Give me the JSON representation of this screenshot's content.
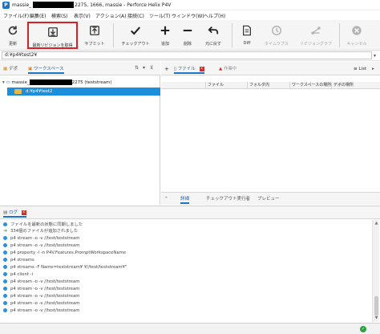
{
  "window": {
    "title_prefix": "massie_",
    "title_suffix": "2275, 1666, massie - Perforce Helix P4V"
  },
  "menu": [
    "ファイル(F)",
    "編集(E)",
    "検索(S)",
    "表示(V)",
    "アクション(A)",
    "接続(C)",
    "ツール(T)",
    "ウィンドウ(W)",
    "ヘルプ(H)"
  ],
  "toolbar": {
    "refresh": "更新",
    "get_latest": "最新リビジョンを取得",
    "submit": "サブミット",
    "checkout": "チェックアウト",
    "add": "追加",
    "delete": "削除",
    "revert": "元に戻す",
    "diff": "Diff",
    "timelapse": "タイムラプス",
    "revision_graph": "リビジョングラフ",
    "cancel": "キャンセル"
  },
  "path": {
    "value": "d:¥p4¥test2¥"
  },
  "left": {
    "tabs": [
      "デポ",
      "ワークスペース"
    ],
    "workspace_prefix": "massie_",
    "workspace_suffix": "2275 (teststream)",
    "selected_folder": "d:¥p4¥test2"
  },
  "right": {
    "tabs": [
      "ファイル",
      "作業中"
    ],
    "list_label": "List",
    "columns": [
      "ファイル",
      "フォルダ内",
      "ワークスペースの場所",
      "デポの場所"
    ],
    "bottom_tabs": [
      "詳細",
      "チェックアウト実行者",
      "プレビュー"
    ]
  },
  "log": {
    "tab": "ログ",
    "lines": [
      {
        "type": "info",
        "text": "ファイルを最新の状態に同期しました"
      },
      {
        "type": "ok",
        "text": "334個のファイルが追加されました"
      },
      {
        "type": "info",
        "text": "p4 stream -o -v //test/teststream"
      },
      {
        "type": "info",
        "text": "p4 stream -o -v //test/teststream"
      },
      {
        "type": "info",
        "text": "p4 property -l -n P4V.Features.PromptWorkspaceName"
      },
      {
        "type": "info",
        "text": "p4 streams"
      },
      {
        "type": "info",
        "text": "p4 streams -F Name=teststream¥ ¥//test/teststream¥\""
      },
      {
        "type": "info",
        "text": "p4 client -i"
      },
      {
        "type": "info",
        "text": "p4 stream -o -v //test/teststream"
      },
      {
        "type": "info",
        "text": "p4 stream -o -v //test/teststream"
      },
      {
        "type": "info",
        "text": "p4 stream -o -v //test/teststream"
      },
      {
        "type": "info",
        "text": "p4 stream -o -v //test/teststream"
      },
      {
        "type": "info",
        "text": "p4 stream -o -v //test/teststream"
      }
    ]
  },
  "colors": {
    "accent": "#1b74c7",
    "selection": "#1b8fdb",
    "highlight_box": "#d81f26"
  }
}
